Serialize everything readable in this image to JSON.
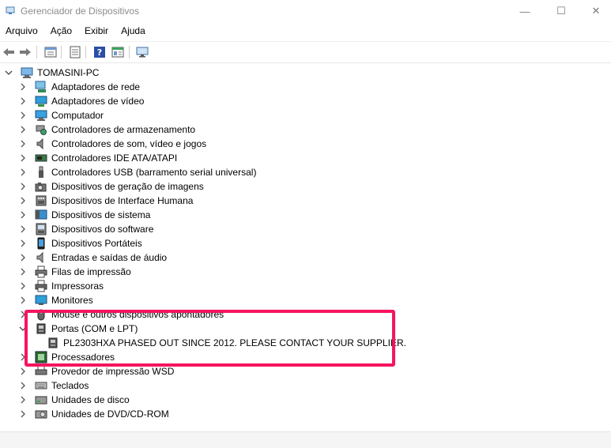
{
  "window": {
    "title": "Gerenciador de Dispositivos",
    "minimize_glyph": "—",
    "maximize_glyph": "☐",
    "close_glyph": "✕"
  },
  "menu": [
    "Arquivo",
    "Ação",
    "Exibir",
    "Ajuda"
  ],
  "toolbar": [
    "back-arrow-icon",
    "forward-arrow-icon",
    "properties-icon",
    "list-view-icon",
    "help-icon",
    "details-view-icon",
    "monitor-icon"
  ],
  "tree": {
    "root": "TOMASINI-PC",
    "categories": [
      "Adaptadores de rede",
      "Adaptadores de vídeo",
      "Computador",
      "Controladores de armazenamento",
      "Controladores de som, vídeo e jogos",
      "Controladores IDE ATA/ATAPI",
      "Controladores USB (barramento serial universal)",
      "Dispositivos de geração de imagens",
      "Dispositivos de Interface Humana",
      "Dispositivos de sistema",
      "Dispositivos do software",
      "Dispositivos Portáteis",
      "Entradas e saídas de áudio",
      "Filas de impressão",
      "Impressoras",
      "Monitores",
      "Mouse e outros dispositivos apontadores",
      "Portas (COM e LPT)",
      "Processadores",
      "Provedor de impressão WSD",
      "Teclados",
      "Unidades de disco",
      "Unidades de DVD/CD-ROM"
    ],
    "port_child": "PL2303HXA PHASED OUT SINCE 2012. PLEASE CONTACT YOUR SUPPLIER."
  },
  "colors": {
    "highlight": "#f5155e"
  }
}
